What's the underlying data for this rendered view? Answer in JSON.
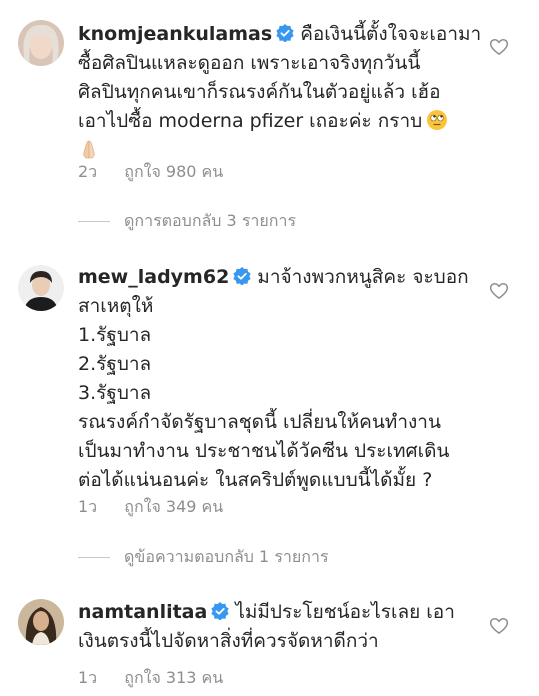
{
  "comments": [
    {
      "username": "knomjeankulamas",
      "lines": [
        "คือเงินนี้ตั้งใจจะเอามา",
        "ซื้อศิลปินแหละดูออก เพราะเอาจริงทุกวันนี้",
        "ศิลปินทุกคนเขาก็รณรงค์กันในตัวอยู่แล้ว เฮ้อ",
        "เอาไปซื้อ moderna pfizer เถอะค่ะ กราบ"
      ],
      "emoji_end": "face-with-rolling-eyes",
      "emoji_line2": "folded-hands",
      "time": "2ว",
      "likes": "ถูกใจ 980 คน",
      "replies": "ดูการตอบกลับ 3 รายการ"
    },
    {
      "username": "mew_ladym62",
      "lines": [
        "มาจ้างพวกหนูสิคะ จะบอก",
        "สาเหตุให้",
        "1.รัฐบาล",
        "2.รัฐบาล",
        "3.รัฐบาล",
        "รณรงค์กำจัดรัฐบาลชุดนี้ เปลี่ยนให้คนทำงาน",
        "เป็นมาทำงาน ประชาชนได้วัคซีน ประเทศเดิน",
        "ต่อได้แน่นอนค่ะ  ในสคริปต์พูดแบบนี้ได้มั้ย ?"
      ],
      "time": "1ว",
      "likes": "ถูกใจ 349 คน",
      "replies": "ดูข้อความตอบกลับ 1 รายการ"
    },
    {
      "username": "namtanlitaa",
      "lines": [
        "ไม่มีประโยชน์อะไรเลย เอา",
        "เงินตรงนี้ไปจัดหาสิ่งที่ควรจัดหาดีกว่า"
      ],
      "time": "1ว",
      "likes": "ถูกใจ 313 คน"
    }
  ],
  "icons": {
    "verified": "verified-badge-icon",
    "like": "heart-outline-icon"
  },
  "colors": {
    "verified": "#3897f0",
    "meta_text": "#8e8e8e",
    "text": "#262626"
  }
}
